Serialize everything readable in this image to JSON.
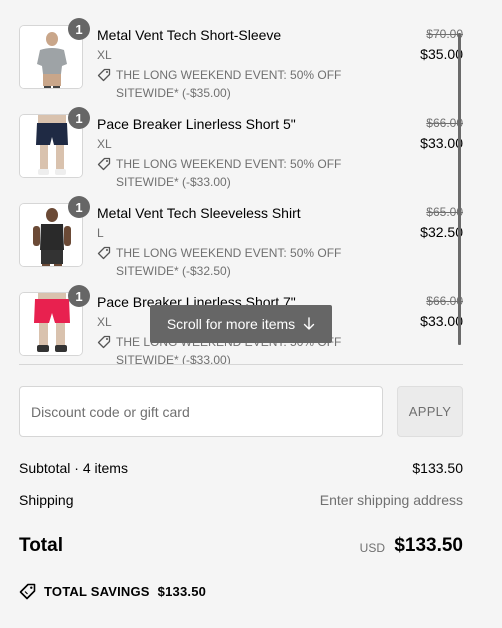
{
  "items": [
    {
      "name": "Metal Vent Tech Short-Sleeve",
      "size": "XL",
      "qty": "1",
      "promo": "THE LONG WEEKEND EVENT: 50% OFF SITEWIDE* (-$35.00)",
      "original_price": "$70.00",
      "price": "$35.00"
    },
    {
      "name": "Pace Breaker Linerless Short 5\"",
      "size": "XL",
      "qty": "1",
      "promo": "THE LONG WEEKEND EVENT: 50% OFF SITEWIDE* (-$33.00)",
      "original_price": "$66.00",
      "price": "$33.00"
    },
    {
      "name": "Metal Vent Tech Sleeveless Shirt",
      "size": "L",
      "qty": "1",
      "promo": "THE LONG WEEKEND EVENT: 50% OFF SITEWIDE* (-$32.50)",
      "original_price": "$65.00",
      "price": "$32.50"
    },
    {
      "name": "Pace Breaker Linerless Short 7\"",
      "size": "XL",
      "qty": "1",
      "promo": "THE LONG WEEKEND EVENT: 50% OFF SITEWIDE* (-$33.00)",
      "original_price": "$66.00",
      "price": "$33.00"
    }
  ],
  "scroll_hint": "Scroll for more items",
  "discount": {
    "placeholder": "Discount code or gift card",
    "apply_label": "APPLY"
  },
  "summary": {
    "subtotal_label": "Subtotal · 4 items",
    "subtotal_value": "$133.50",
    "shipping_label": "Shipping",
    "shipping_value": "Enter shipping address",
    "total_label": "Total",
    "currency": "USD",
    "total_value": "$133.50",
    "savings_label": "TOTAL SAVINGS",
    "savings_value": "$133.50"
  },
  "colors": {
    "background": "#f5f5f5",
    "badge": "#666666",
    "muted_text": "#707070"
  }
}
